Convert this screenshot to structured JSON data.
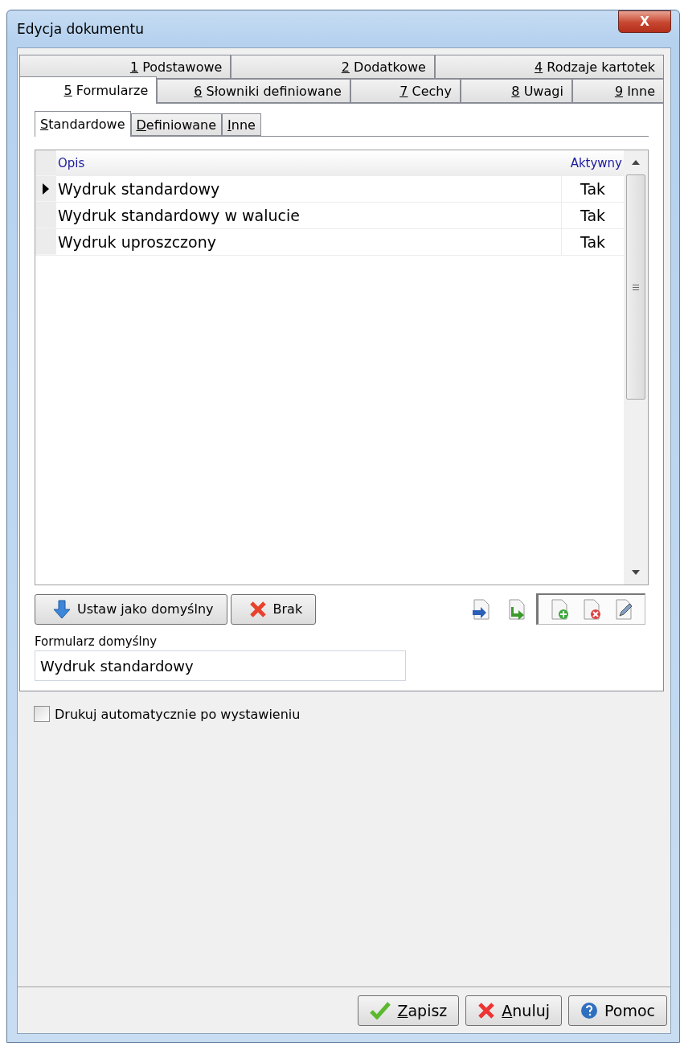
{
  "window": {
    "title": "Edycja dokumentu",
    "close_label": "X"
  },
  "tab_rows": [
    [
      {
        "mnemonic": "1",
        "text": " Podstawowe",
        "selected": false
      },
      {
        "mnemonic": "2",
        "text": " Dodatkowe",
        "selected": false
      },
      {
        "mnemonic": "4",
        "text": " Rodzaje kartotek",
        "selected": false
      }
    ],
    [
      {
        "mnemonic": "5",
        "text": " Formularze",
        "selected": true
      },
      {
        "mnemonic": "6",
        "text": " Słowniki definiowane",
        "selected": false
      },
      {
        "mnemonic": "7",
        "text": " Cechy",
        "selected": false
      },
      {
        "mnemonic": "8",
        "text": " Uwagi",
        "selected": false
      },
      {
        "mnemonic": "9",
        "text": " Inne",
        "selected": false
      }
    ]
  ],
  "subtabs": [
    {
      "mnemonic": "S",
      "text": "tandardowe",
      "selected": true
    },
    {
      "mnemonic": "D",
      "text": "efiniowane",
      "selected": false
    },
    {
      "mnemonic": "I",
      "text": "nne",
      "selected": false
    }
  ],
  "table": {
    "columns": [
      "Opis",
      "Aktywny"
    ],
    "rows": [
      {
        "cells": [
          "Wydruk standardowy",
          "Tak"
        ],
        "selected": true
      },
      {
        "cells": [
          "Wydruk standardowy w walucie",
          "Tak"
        ],
        "selected": false
      },
      {
        "cells": [
          "Wydruk uproszczony",
          "Tak"
        ],
        "selected": false
      }
    ]
  },
  "actions": [
    {
      "kind": "default",
      "label": "Ustaw jako domyślny"
    },
    {
      "kind": "none",
      "label": "Brak"
    }
  ],
  "default_form": {
    "label": "Formularz domyślny",
    "value": "Wydruk standardowy"
  },
  "auto_print": {
    "label": "Drukuj automatycznie po wystawieniu",
    "checked": false
  },
  "footer_buttons": [
    {
      "kind": "save",
      "mnemonic": "Z",
      "text": "apisz"
    },
    {
      "kind": "cancel",
      "mnemonic": "A",
      "text": "nuluj"
    },
    {
      "kind": "help",
      "text": "Pomoc"
    }
  ]
}
